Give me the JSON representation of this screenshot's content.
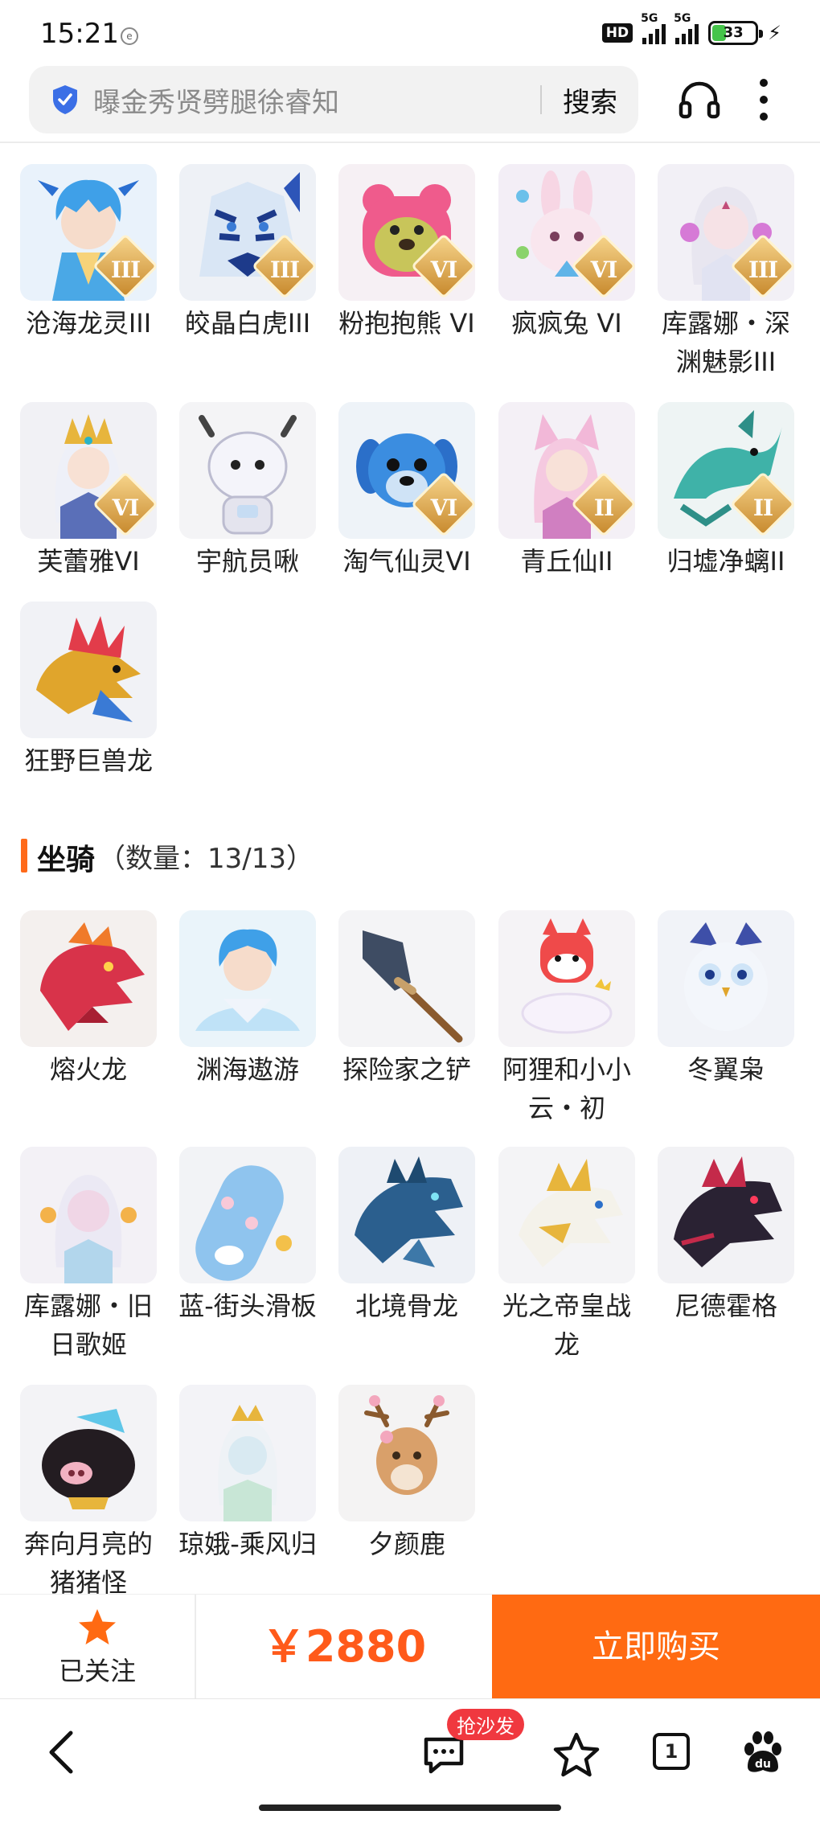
{
  "status_bar": {
    "time": "15:21",
    "network_badge": "HD",
    "signal_1": "5G",
    "signal_2": "5G",
    "battery_percent": 33,
    "battery": "33"
  },
  "search": {
    "query": "曝金秀贤劈腿徐睿知",
    "button": "搜索"
  },
  "items_top": [
    {
      "label": "沧海龙灵III",
      "rank": "III",
      "icon": "blue-dragon-spirit-icon"
    },
    {
      "label": "皎晶白虎III",
      "rank": "III",
      "icon": "blue-white-tiger-icon"
    },
    {
      "label": "粉抱抱熊 VI",
      "rank": "VI",
      "icon": "pink-bear-icon"
    },
    {
      "label": "疯疯兔 VI",
      "rank": "VI",
      "icon": "pink-rabbit-icon"
    },
    {
      "label": "库露娜・深渊魅影III",
      "rank": "III",
      "icon": "white-hair-girl-icon"
    },
    {
      "label": "芙蕾雅VI",
      "rank": "VI",
      "icon": "golden-crown-girl-icon"
    },
    {
      "label": "宇航员啾",
      "rank": "",
      "icon": "astronaut-cow-icon"
    },
    {
      "label": "淘气仙灵VI",
      "rank": "VI",
      "icon": "blue-dog-icon"
    },
    {
      "label": "青丘仙II",
      "rank": "II",
      "icon": "fox-fairy-icon"
    },
    {
      "label": "归墟净螭II",
      "rank": "II",
      "icon": "teal-dragon-icon"
    },
    {
      "label": "狂野巨兽龙",
      "rank": "",
      "icon": "wild-dragon-icon"
    }
  ],
  "section": {
    "title": "坐骑",
    "count": "（数量：13/13）"
  },
  "mounts": [
    {
      "label": "熔火龙",
      "icon": "red-dragon-icon"
    },
    {
      "label": "渊海遨游",
      "icon": "sea-dragon-rider-icon"
    },
    {
      "label": "探险家之铲",
      "icon": "shovel-icon"
    },
    {
      "label": "阿狸和小小云・初",
      "icon": "fox-cloud-icon"
    },
    {
      "label": "冬翼枭",
      "icon": "owl-icon"
    },
    {
      "label": "库露娜・旧日歌姬",
      "icon": "singer-girl-icon"
    },
    {
      "label": "蓝-街头滑板",
      "icon": "skateboard-icon"
    },
    {
      "label": "北境骨龙",
      "icon": "bone-dragon-icon"
    },
    {
      "label": "光之帝皇战龙",
      "icon": "golden-dragon-icon"
    },
    {
      "label": "尼德霍格",
      "icon": "dark-dragon-icon"
    },
    {
      "label": "奔向月亮的猪猪怪",
      "icon": "pig-icon"
    },
    {
      "label": "琼娥-乘风归",
      "icon": "moon-fairy-icon"
    },
    {
      "label": "夕颜鹿",
      "icon": "deer-icon"
    }
  ],
  "action_bar": {
    "follow_label": "已关注",
    "price": "￥2880",
    "buy_label": "立即购买"
  },
  "bottom_nav": {
    "badge": "抢沙发",
    "tab_count": "1"
  },
  "colors": {
    "accent": "#ff6a12",
    "price": "#ff5a1a",
    "badge": "#f0383f",
    "follow_star": "#ff6a12"
  }
}
